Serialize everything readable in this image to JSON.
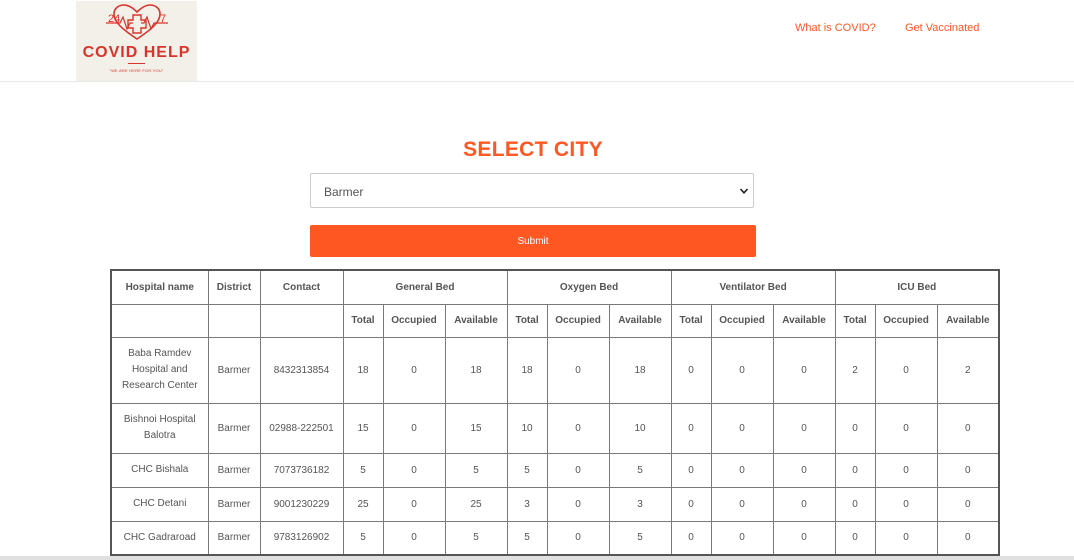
{
  "header": {
    "logo": {
      "top_left": "24",
      "top_right": "7",
      "title": "COVID HELP",
      "tagline": "\"WE ARE HERE FOR YOU\""
    },
    "nav": {
      "what_is_covid": "What is COVID?",
      "get_vaccinated": "Get Vaccinated"
    }
  },
  "form": {
    "heading": "SELECT CITY",
    "city_value": "Barmer",
    "submit_label": "Submit"
  },
  "table": {
    "headers": {
      "hospital": "Hospital name",
      "district": "District",
      "contact": "Contact",
      "general": "General Bed",
      "oxygen": "Oxygen Bed",
      "ventilator": "Ventilator Bed",
      "icu": "ICU Bed",
      "total": "Total",
      "occupied": "Occupied",
      "available": "Available"
    },
    "rows": [
      {
        "name": "Baba Ramdev Hospital and Research Center",
        "district": "Barmer",
        "contact": "8432313854",
        "vals": [
          "18",
          "0",
          "18",
          "18",
          "0",
          "18",
          "0",
          "0",
          "0",
          "2",
          "0",
          "2"
        ]
      },
      {
        "name": "Bishnoi Hospital Balotra",
        "district": "Barmer",
        "contact": "02988-222501",
        "vals": [
          "15",
          "0",
          "15",
          "10",
          "0",
          "10",
          "0",
          "0",
          "0",
          "0",
          "0",
          "0"
        ]
      },
      {
        "name": "CHC Bishala",
        "district": "Barmer",
        "contact": "7073736182",
        "vals": [
          "5",
          "0",
          "5",
          "5",
          "0",
          "5",
          "0",
          "0",
          "0",
          "0",
          "0",
          "0"
        ]
      },
      {
        "name": "CHC Detani",
        "district": "Barmer",
        "contact": "9001230229",
        "vals": [
          "25",
          "0",
          "25",
          "3",
          "0",
          "3",
          "0",
          "0",
          "0",
          "0",
          "0",
          "0"
        ]
      },
      {
        "name": "CHC Gadraroad",
        "district": "Barmer",
        "contact": "9783126902",
        "vals": [
          "5",
          "0",
          "5",
          "5",
          "0",
          "5",
          "0",
          "0",
          "0",
          "0",
          "0",
          "0"
        ]
      }
    ]
  }
}
